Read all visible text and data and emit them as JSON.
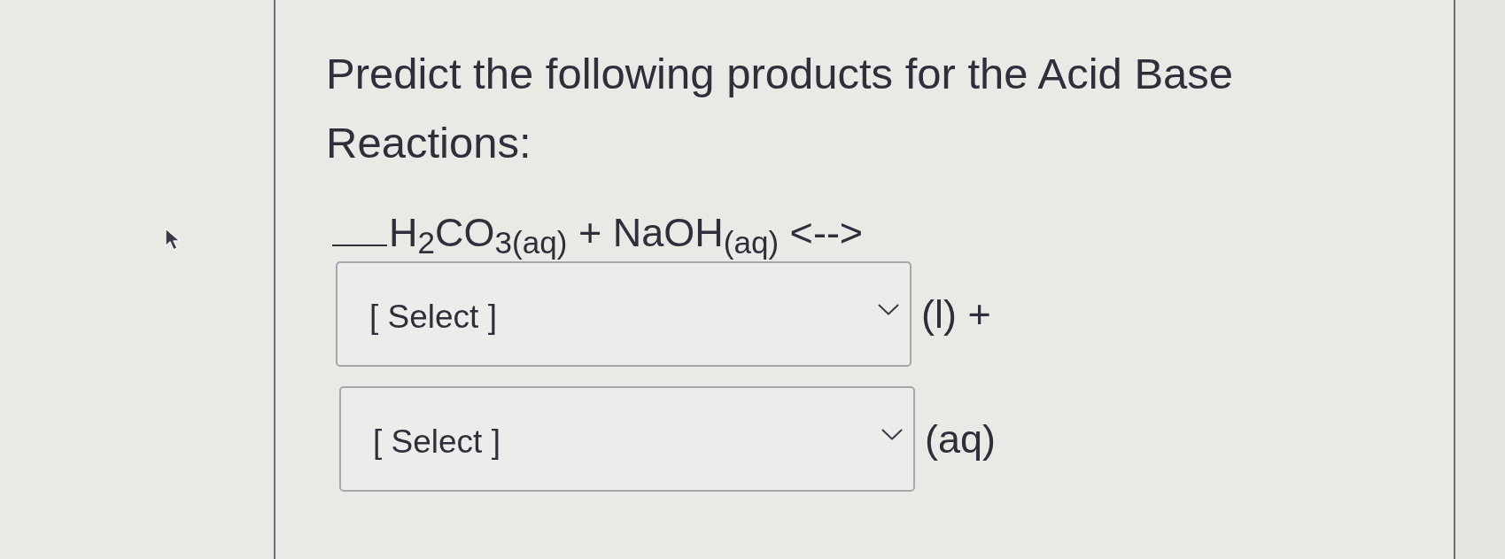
{
  "question": {
    "text": "Predict the following products for the Acid Base Reactions:"
  },
  "equation": {
    "text": "H$_{2}$CO$_{3(aq)}$ + NaOH$_{(aq)}$ <-->"
  },
  "answers": [
    {
      "value": "[ Select ]",
      "suffix": "(l) +"
    },
    {
      "value": "[ Select ]",
      "suffix": "(aq)"
    }
  ]
}
